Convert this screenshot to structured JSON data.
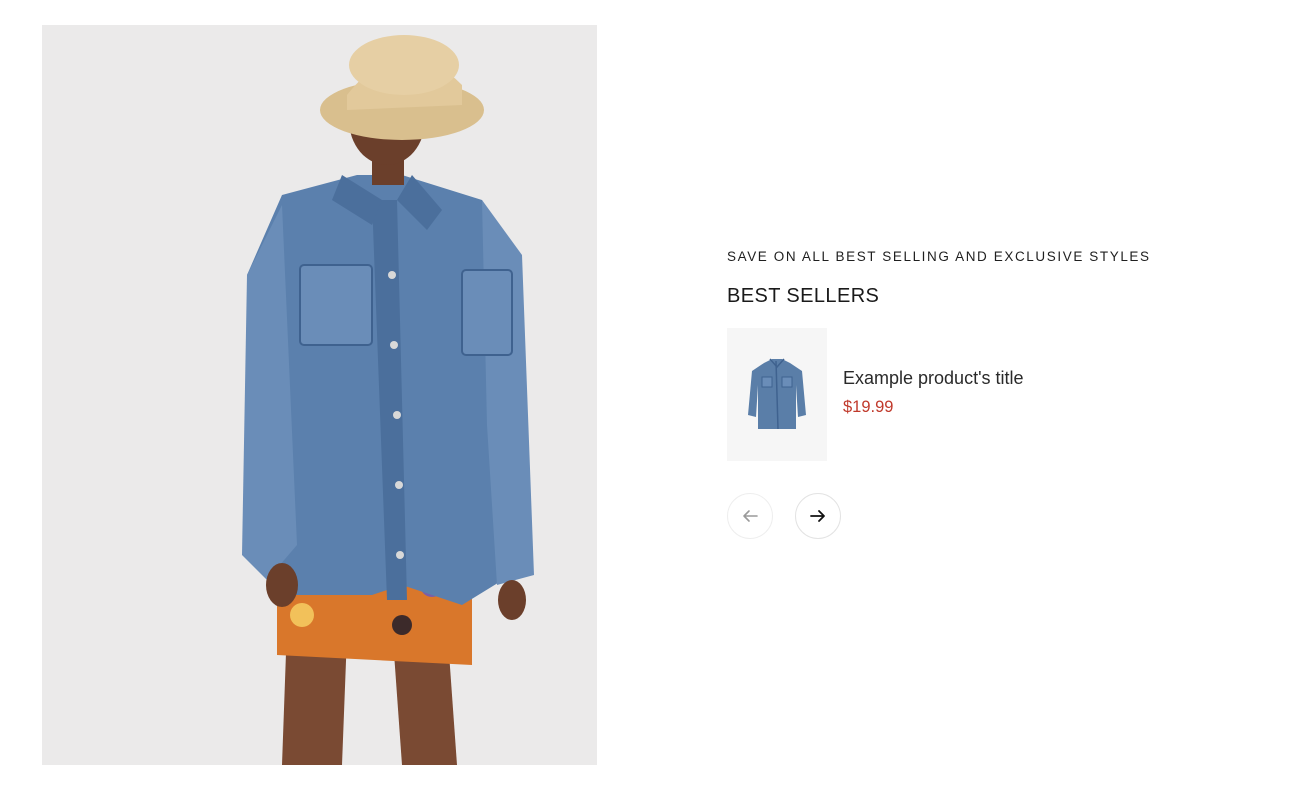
{
  "hero": {
    "image_subject": "model wearing oversized denim jacket, floral dress and straw bucket hat"
  },
  "section": {
    "eyebrow": "SAVE ON ALL BEST SELLING AND EXCLUSIVE STYLES",
    "heading": "BEST SELLERS"
  },
  "product": {
    "title": "Example product's title",
    "price": "$19.99",
    "price_color": "#c0392b",
    "thumb_icon": "denim-jacket-image"
  },
  "navigation": {
    "prev_icon": "arrow-left-icon",
    "next_icon": "arrow-right-icon",
    "prev_disabled_color": "#9a9a9a",
    "next_color": "#111111"
  }
}
